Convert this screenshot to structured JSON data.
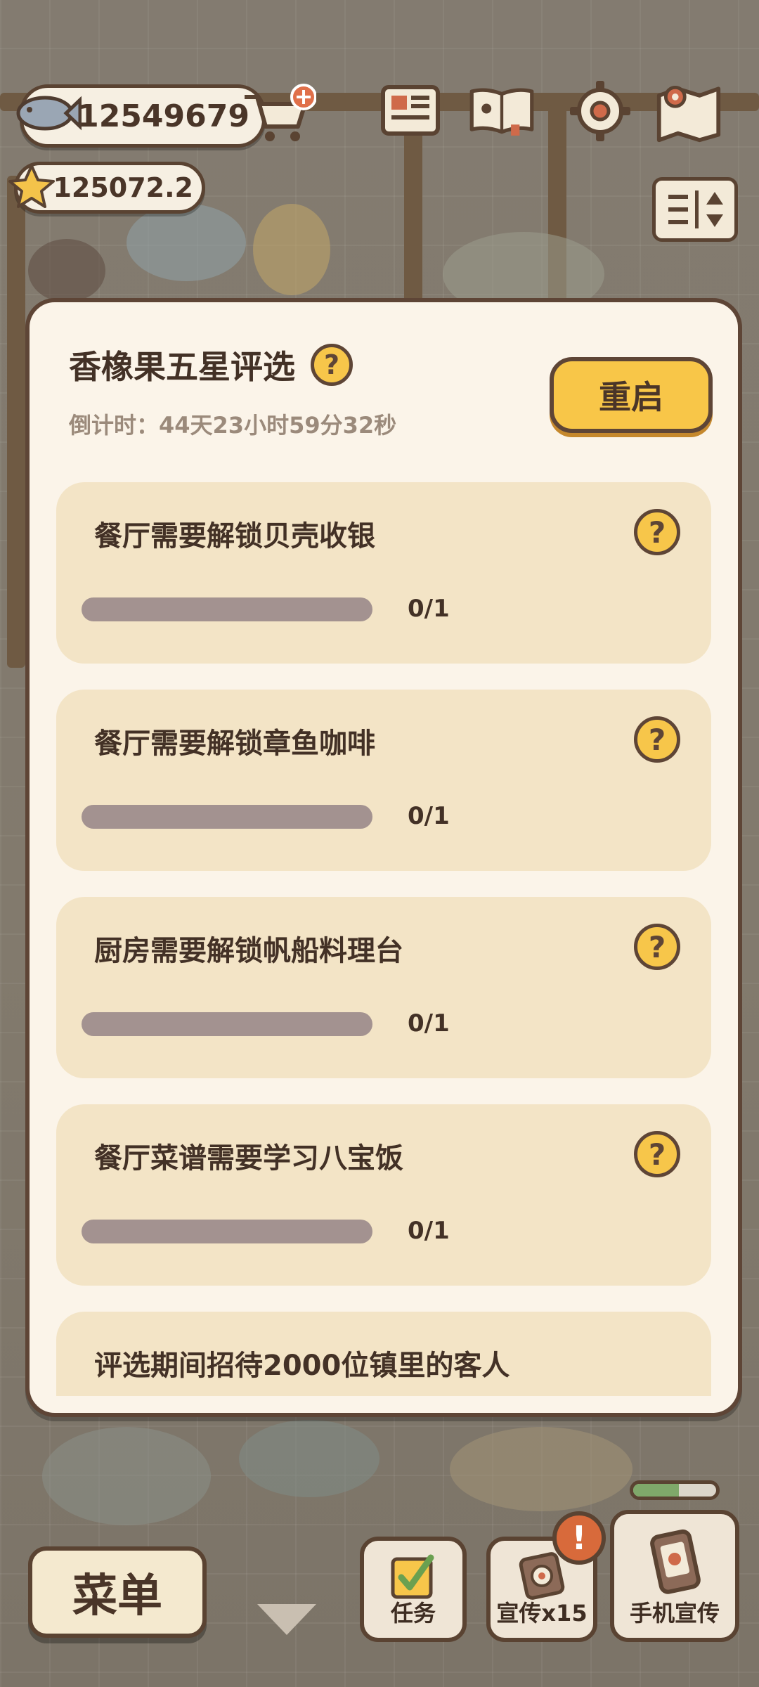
{
  "hud": {
    "fish_currency": "12549679",
    "star_currency": "125072.2"
  },
  "dialog": {
    "title": "香橡果五星评选",
    "countdown": "倒计时：44天23小时59分32秒",
    "restart_label": "重启",
    "help_glyph": "?",
    "tasks": [
      {
        "label": "餐厅需要解锁贝壳收银",
        "progress_text": "0/1",
        "progress": 0
      },
      {
        "label": "餐厅需要解锁章鱼咖啡",
        "progress_text": "0/1",
        "progress": 0
      },
      {
        "label": "厨房需要解锁帆船料理台",
        "progress_text": "0/1",
        "progress": 0
      },
      {
        "label": "餐厅菜谱需要学习八宝饭",
        "progress_text": "0/1",
        "progress": 0
      },
      {
        "label": "评选期间招待2000位镇里的客人",
        "progress_text": "",
        "progress": 0
      }
    ]
  },
  "bottom_bar": {
    "menu_label": "菜单",
    "tasks_label": "任务",
    "promote_label": "宣传x15",
    "phone_promote_label": "手机宣传",
    "alert_glyph": "!",
    "phone_promote_fill": 0.55
  },
  "colors": {
    "accent_yellow": "#f8c648",
    "outline_brown": "#5e4536",
    "card_bg": "#f3e4c6",
    "modal_bg": "#fbf4e9"
  },
  "icons": [
    "fish-icon",
    "shop-cart-icon",
    "star-icon",
    "newspaper-icon",
    "book-icon",
    "gear-icon",
    "map-icon",
    "sort-icon",
    "help-icon",
    "checklist-icon",
    "promotion-card-icon",
    "phone-icon"
  ]
}
